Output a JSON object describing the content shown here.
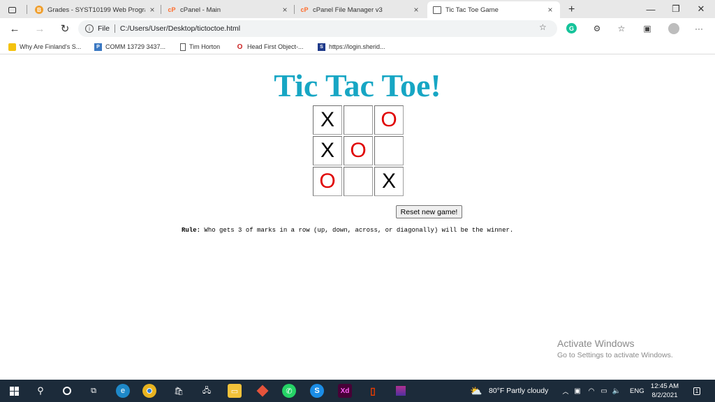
{
  "tabs": [
    {
      "label": "Grades - SYST10199 Web Progra",
      "icon": "blackboard-icon",
      "color": "#f0a030"
    },
    {
      "label": "cPanel - Main",
      "icon": "cpanel-icon",
      "color": "#ff6c2c"
    },
    {
      "label": "cPanel File Manager v3",
      "icon": "cpanel-icon",
      "color": "#ff6c2c"
    },
    {
      "label": "Tic Tac Toe Game",
      "icon": "page-icon",
      "active": true
    }
  ],
  "close_glyph": "×",
  "new_tab_glyph": "+",
  "window": {
    "minimize": "—",
    "restore": "❐",
    "close": "✕"
  },
  "address": {
    "scheme_label": "File",
    "url": "C:/Users/User/Desktop/tictoctoe.html"
  },
  "bookmarks": [
    {
      "label": "Why Are Finland's S...",
      "icon": "sun-icon",
      "color": "#f4c20d"
    },
    {
      "label": "COMM 13729 3437...",
      "icon": "p-icon",
      "color": "#3a78c2",
      "glyph": "P"
    },
    {
      "label": "Tim Horton",
      "icon": "page-icon"
    },
    {
      "label": "Head First Object-...",
      "icon": "o-icon",
      "color": "#cc2222",
      "glyph": "O"
    },
    {
      "label": "https://login.sherid...",
      "icon": "s-icon",
      "color": "#1f3a8a",
      "glyph": "S"
    }
  ],
  "page": {
    "title": "Tic Tac Toe!",
    "board": [
      [
        "X",
        "",
        "O"
      ],
      [
        "X",
        "O",
        ""
      ],
      [
        "O",
        "",
        "X"
      ]
    ],
    "reset_label": "Reset new game!",
    "rule_label": "Rule:",
    "rule_text": " Who gets 3 of marks in a row (up, down, across, or diagonally) will be the winner."
  },
  "watermark": {
    "line1": "Activate Windows",
    "line2": "Go to Settings to activate Windows."
  },
  "taskbar": {
    "weather": "80°F  Partly cloudy",
    "language": "ENG",
    "time": "12:45 AM",
    "date": "8/2/2021",
    "notification_count": "1"
  },
  "colors": {
    "title": "#17a6c4",
    "o_mark": "#e00000",
    "x_mark": "#000000",
    "taskbar": "#1c2b3a"
  }
}
